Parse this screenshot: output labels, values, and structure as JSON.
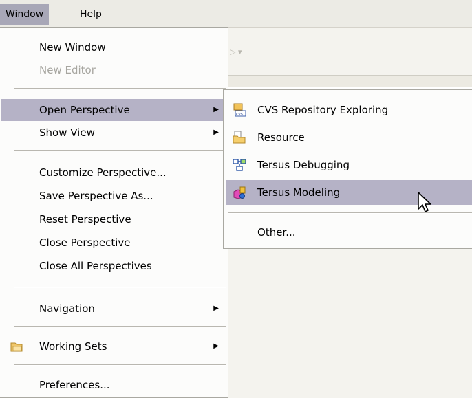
{
  "menubar": {
    "items": [
      {
        "label": "Window"
      },
      {
        "label": "Help"
      }
    ]
  },
  "window_menu": {
    "groups": [
      [
        {
          "label": "New Window",
          "enabled": true
        },
        {
          "label": "New Editor",
          "enabled": false
        }
      ],
      [
        {
          "label": "Open Perspective",
          "submenu": true,
          "highlighted": true
        },
        {
          "label": "Show View",
          "submenu": true
        }
      ],
      [
        {
          "label": "Customize Perspective..."
        },
        {
          "label": "Save Perspective As..."
        },
        {
          "label": "Reset Perspective"
        },
        {
          "label": "Close Perspective"
        },
        {
          "label": "Close All Perspectives"
        }
      ],
      [
        {
          "label": "Navigation",
          "submenu": true
        }
      ],
      [
        {
          "label": "Working Sets",
          "submenu": true,
          "icon": "working-sets-folder-icon"
        }
      ],
      [
        {
          "label": "Preferences..."
        }
      ]
    ],
    "items": {
      "new_window": "New Window",
      "new_editor": "New Editor",
      "open_perspective": "Open Perspective",
      "show_view": "Show View",
      "customize_perspective": "Customize Perspective...",
      "save_perspective_as": "Save Perspective As...",
      "reset_perspective": "Reset Perspective",
      "close_perspective": "Close Perspective",
      "close_all_perspectives": "Close All Perspectives",
      "navigation": "Navigation",
      "working_sets": "Working Sets",
      "preferences": "Preferences..."
    }
  },
  "open_perspective_submenu": {
    "items": {
      "cvs": "CVS Repository Exploring",
      "resource": "Resource",
      "tersus_debugging": "Tersus Debugging",
      "tersus_modeling": "Tersus Modeling",
      "other": "Other..."
    },
    "icons": {
      "cvs": "cvs-repository-icon",
      "resource": "resource-folder-icon",
      "tersus_debugging": "tersus-debug-icon",
      "tersus_modeling": "tersus-modeling-icon"
    },
    "highlighted": "tersus_modeling"
  },
  "colors": {
    "highlight": "#b5b2c6",
    "menubar_active": "#a8a7b7",
    "disabled_text": "#a7a6a0"
  }
}
